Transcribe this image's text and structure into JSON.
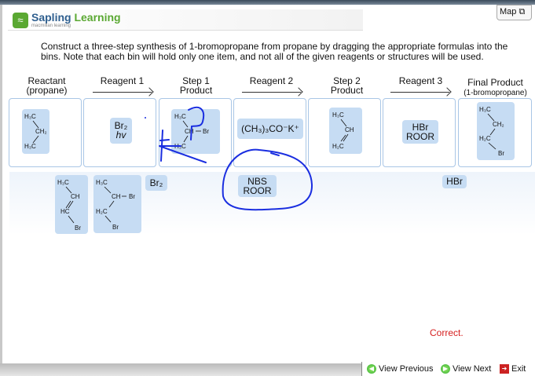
{
  "header": {
    "brand_a": "Sapling",
    "brand_b": "Learning",
    "subtitle": "macmillan learning",
    "map_label": "Map"
  },
  "instructions": "Construct a three-step synthesis of 1-bromopropane from propane by dragging the appropriate formulas into the bins. Note that each bin will hold only one item, and not all of the given reagents or structures will be used.",
  "columns": {
    "reactant": "Reactant",
    "reactant_sub": "(propane)",
    "reagent1": "Reagent 1",
    "step1a": "Step 1",
    "step1b": "Product",
    "reagent2": "Reagent 2",
    "step2a": "Step 2",
    "step2b": "Product",
    "reagent3": "Reagent 3",
    "final": "Final Product",
    "final_sub": "(1-bromopropane)"
  },
  "bins": {
    "reactant": {
      "a": "H₃C",
      "b": "CH₂",
      "c": "H₃C"
    },
    "reagent1": {
      "line1": "Br₂",
      "line2": "hv"
    },
    "step1": {
      "a": "H₃C",
      "b": "CH",
      "br": "Br",
      "c": "H₃C"
    },
    "reagent2": {
      "label": "(CH₃)₃CO⁻K⁺"
    },
    "step2": {
      "a": "H₃C",
      "b": "CH",
      "c": "H₂C"
    },
    "reagent3": {
      "line1": "HBr",
      "line2": "ROOR"
    },
    "final": {
      "a": "H₃C",
      "b": "CH₂",
      "c": "H₂C",
      "br": "Br"
    }
  },
  "tray": {
    "vinyl": {
      "a": "H₃C",
      "b": "CH",
      "c": "HC",
      "br": "Br"
    },
    "dibromo": {
      "a": "H₃C",
      "b": "CH",
      "br1": "Br",
      "c": "H₂C",
      "br2": "Br"
    },
    "br2": "Br₂",
    "nbs": {
      "line1": "NBS",
      "line2": "ROOR"
    },
    "hbr": "HBr"
  },
  "status": "Correct.",
  "footer": {
    "prev": "View Previous",
    "next": "View Next",
    "exit": "Exit"
  },
  "colors": {
    "annotation": "#1a2ee0",
    "chip": "#c6dcf3",
    "correct": "#d62020"
  }
}
